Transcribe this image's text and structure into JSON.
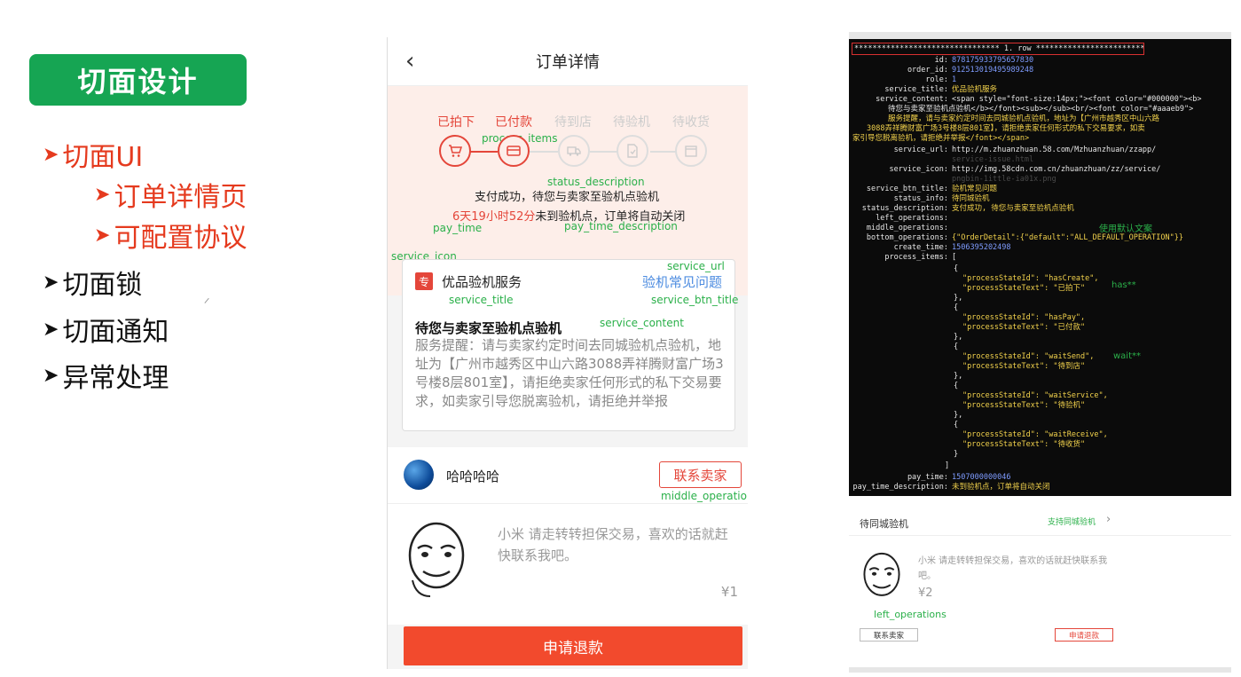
{
  "slide": {
    "title": "切面设计",
    "bullets": [
      {
        "text": "切面UI",
        "level": 0,
        "color": "#e53a1e"
      },
      {
        "text": "订单详情页",
        "level": 1,
        "color": "#e53a1e"
      },
      {
        "text": "可配置协议",
        "level": 1,
        "color": "#e53a1e"
      },
      {
        "text": "切面锁",
        "level": 0,
        "color": "#111111"
      },
      {
        "text": "切面通知",
        "level": 0,
        "color": "#111111"
      },
      {
        "text": "异常处理",
        "level": 0,
        "color": "#111111"
      }
    ],
    "colors": {
      "badge": "#16a553",
      "highlight": "#e53a1e"
    }
  },
  "phone": {
    "back_icon": "chevron-left-icon",
    "header_title": "订单详情",
    "steps": [
      {
        "label": "已拍下",
        "active": true,
        "icon": "cart-icon"
      },
      {
        "label": "已付款",
        "active": true,
        "icon": "card-icon"
      },
      {
        "label": "待到店",
        "active": false,
        "icon": "truck-icon"
      },
      {
        "label": "待验机",
        "active": false,
        "icon": "document-icon"
      },
      {
        "label": "待收货",
        "active": false,
        "icon": "box-icon"
      }
    ],
    "annotations": {
      "process_items": "process_items",
      "status_description": "status_description",
      "pay_time": "pay_time",
      "pay_time_description": "pay_time_description",
      "service_icon": "service_icon",
      "service_url": "service_url",
      "service_title": "service_title",
      "service_btn_title": "service_btn_title",
      "service_content": "service_content",
      "middle_operation": "middle_operation",
      "bottom_operations": "bottom_operations"
    },
    "status_text": "支付成功，待您与卖家至验机点验机",
    "pay_time_highlight": "6天19小时52分",
    "pay_time_rest": "未到验机点，订单将自动关闭",
    "service": {
      "icon_char": "专",
      "title": "优品验机服务",
      "btn_title": "验机常见问题",
      "heading": "待您与卖家至验机点验机",
      "content": "服务提醒：请与卖家约定时间去同城验机点验机，地址为【广州市越秀区中山六路3088弄祥腾财富广场3号楼8层801室】，请拒绝卖家任何形式的私下交易要求，如卖家引导您脱离验机，请拒绝并举报"
    },
    "seller": {
      "name": "哈哈哈哈",
      "contact_button": "联系卖家",
      "item_description": "小米 请走转转担保交易，喜欢的话就赶快联系我吧。",
      "price": "¥1"
    },
    "refund_button": "申请退款",
    "colors": {
      "accent": "#e4463a",
      "link": "#4d8ce0",
      "status_bg": "#fdeee9",
      "refund": "#f24a2d"
    }
  },
  "terminal": {
    "header": "******************************** 1. row *******************************",
    "fields": [
      {
        "key": "id:",
        "value": "878175933795657830",
        "color": "blue"
      },
      {
        "key": "order_id:",
        "value": "912513019495989248",
        "color": "blue"
      },
      {
        "key": "role:",
        "value": "1",
        "color": "blue"
      },
      {
        "key": "service_title:",
        "value": "优品验机服务",
        "color": "yellow"
      },
      {
        "key": "service_content:",
        "value": "<span style=\"font-size:14px;\"><font color=\"#000000\"><b>",
        "color": "yellow"
      }
    ],
    "content_lines": [
      "待您与卖家至验机点验机</b></font><sub></sub><br/><font color=\"#aaaeb9\">",
      "服务提醒，请与卖家约定时间去同城验机点验机，地址为【广州市越秀区中山六路",
      "3088弄祥腾财富广场3号楼8层801室】，请拒绝卖家任何形式的私下交易要求，如卖",
      "家引导您脱离验机，请拒绝并举报</font></span>"
    ],
    "fields2": [
      {
        "key": "service_url:",
        "value": "http://m.zhuanzhuan.58.com/Mzhuanzhuan/zzapp/",
        "color": "white"
      },
      {
        "key": "",
        "value": "service-issue.html",
        "color": "gray"
      },
      {
        "key": "service_icon:",
        "value": "http://img.58cdn.com.cn/zhuanzhuan/zz/service/",
        "color": "white"
      },
      {
        "key": "",
        "value": "pngbin-1ittle-ia01x.png",
        "color": "gray"
      },
      {
        "key": "service_btn_title:",
        "value": "验机常见问题",
        "color": "yellow"
      },
      {
        "key": "status_info:",
        "value": "待同城验机",
        "color": "yellow"
      },
      {
        "key": "status_description:",
        "value": "支付成功, 待您与卖家至验机点验机",
        "color": "yellow"
      },
      {
        "key": "left_operations:",
        "value": "",
        "color": "yellow"
      },
      {
        "key": "middle_operations:",
        "value": "",
        "color": "yellow"
      },
      {
        "key": "bottom_operations:",
        "value": "{\"OrderDetail\":{\"default\":\"ALL_DEFAULT_OPERATION\"}}",
        "color": "yellow"
      },
      {
        "key": "create_time:",
        "value": "1506395202498",
        "color": "blue"
      },
      {
        "key": "process_items:",
        "value": "[",
        "color": "yellow"
      }
    ],
    "process_items": [
      {
        "id": "\"processStateId\": \"hasCreate\",",
        "text": "\"processStateText\": \"已拍下\""
      },
      {
        "id": "\"processStateId\": \"hasPay\",",
        "text": "\"processStateText\": \"已付款\""
      },
      {
        "id": "\"processStateId\": \"waitSend\",",
        "text": "\"processStateText\": \"待到店\""
      },
      {
        "id": "\"processStateId\": \"waitService\",",
        "text": "\"processStateText\": \"待验机\""
      },
      {
        "id": "\"processStateId\": \"waitReceive\",",
        "text": "\"processStateText\": \"待收货\""
      }
    ],
    "annotations": {
      "default_text": "使用默认文案",
      "has": "has**",
      "wait": "wait**"
    },
    "pay_time": {
      "key": "pay_time:",
      "value": "1507000000046"
    },
    "pay_time_description": {
      "key": "pay_time_description:",
      "value": "未到验机点，订单将自动关闭"
    }
  },
  "mini": {
    "title": "待同城验机",
    "link": "支持同城验机",
    "chevron": "›",
    "description": "小米 请走转转担保交易，喜欢的话就赶快联系我吧。",
    "price": "¥2",
    "annotation": "left_operations",
    "contact_button": "联系卖家",
    "refund_button": "申请退款"
  }
}
